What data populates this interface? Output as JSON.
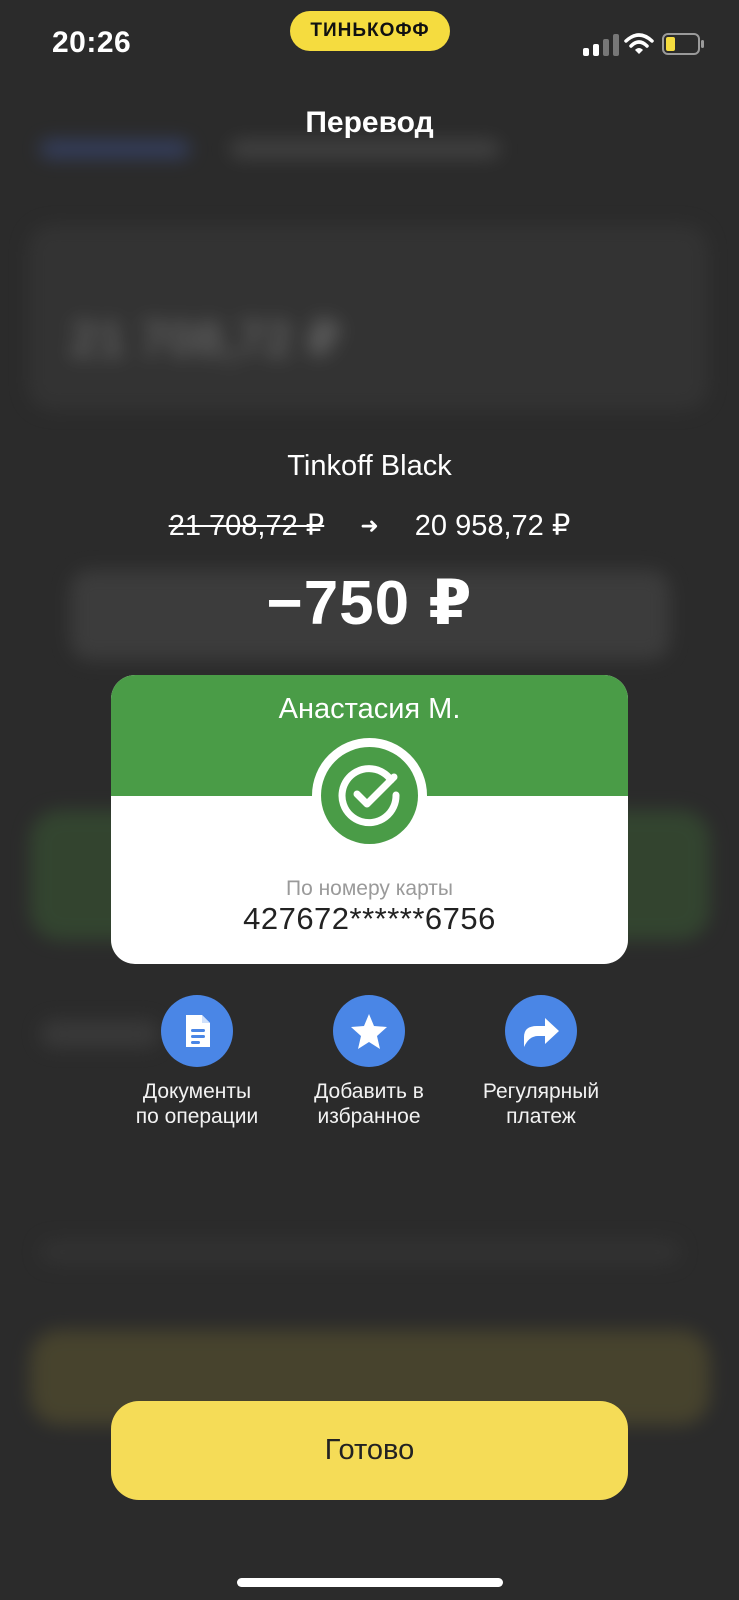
{
  "status_bar": {
    "time": "20:26",
    "brand": "ТИНЬКОФФ",
    "icons": [
      "cellular-signal-icon",
      "wifi-icon",
      "battery-low-icon"
    ],
    "battery_color": "#f5dc3f"
  },
  "header": {
    "title": "Перевод"
  },
  "transfer": {
    "account_name": "Tinkoff Black",
    "balance_before": "21 708,72 ₽",
    "balance_after": "20 958,72 ₽",
    "amount": "−750 ₽"
  },
  "recipient_card": {
    "name": "Анастасия М.",
    "status_icon": "success-check-icon",
    "method_label": "По номеру карты",
    "card_number": "427672******6756",
    "accent_color": "#4a9c47"
  },
  "actions": [
    {
      "label": "Документы\nпо операции",
      "icon": "document-icon"
    },
    {
      "label": "Добавить в\nизбранное",
      "icon": "star-icon"
    },
    {
      "label": "Регулярный\nплатеж",
      "icon": "share-arrow-icon"
    }
  ],
  "done_button": {
    "label": "Готово",
    "color": "#f5dc57"
  }
}
